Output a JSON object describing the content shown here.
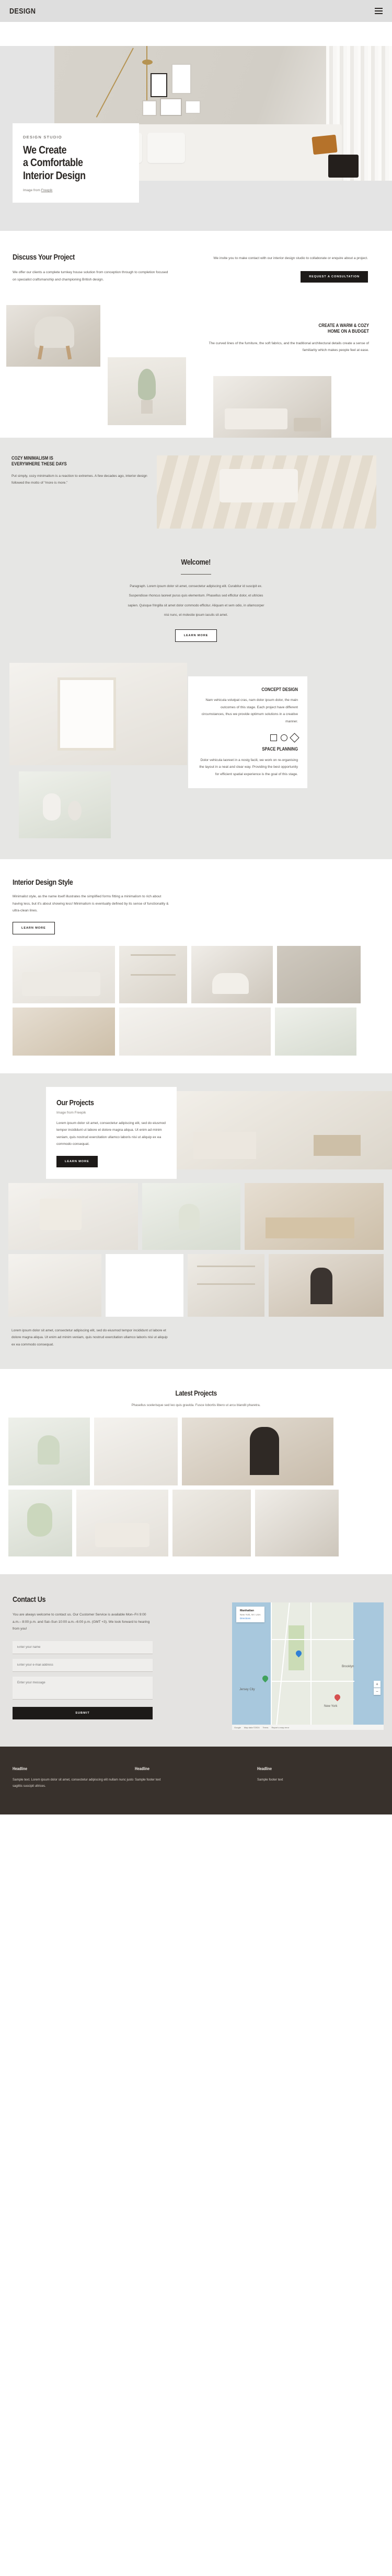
{
  "header": {
    "logo": "DESIGN",
    "menu_icon": "hamburger-icon"
  },
  "hero": {
    "kicker": "DESIGN STUDIO",
    "title": "We Create\na Comfortable\nInterior Design",
    "credit_prefix": "Image from ",
    "credit_link": "Freepik"
  },
  "discuss": {
    "title": "Discuss Your Project",
    "body": "We offer our clients a complete turnkey house solution from conception through to completion focused on specialist craftsmanship and championing British design.",
    "invite": "We invite you to make contact with our interior design studio to collaborate or enquire about a project.",
    "button": "REQUEST A CONSULTATION"
  },
  "warm": {
    "title": "CREATE A WARM & COZY\nHOME ON A BUDGET",
    "body": "The curved lines of the furniture, the soft fabrics, and the traditional architectural details create a sense of familiarity which makes people feel at ease."
  },
  "cozy": {
    "title": "COZY MINIMALISM IS\nEVERYWHERE THESE DAYS",
    "body": "Put simply, cozy minimalism is a reaction to extremes. A few decades ago, interior design followed the motto of “more is more.”"
  },
  "welcome": {
    "title": "Welcome!",
    "paragraphs": [
      "Paragraph. Lorem ipsum dolor sit amet, consectetur adipiscing elit. Curabitur id suscipit ex.",
      "Suspendisse rhoncus laoreet purus quis elementum. Phasellus sed efficitur dolor, et ultricies",
      "sapien. Quisque fringilla sit amet dolor commodo efficitur. Aliquam et sem odio, in ullamcorper",
      "nisi nunc, et molestie ipsum iaculis sit amet."
    ],
    "button": "LEARN MORE"
  },
  "concept": {
    "title": "CONCEPT DESIGN",
    "body": "Nam vehicula volutpat cras, nam dolor ipsum dolor, the main outcomes of this stage. Each project have different circumstances, thus we provide optimum solutions in a creative manner.",
    "planning_title": "SPACE PLANNING",
    "planning_body": "Dolor vehicula laoreet in a nostg facili, we work on re-organising the layout in a neat and clear way. Providing the best opportunity for efficient spatial experience is the goal of this stage."
  },
  "style": {
    "title": "Interior Design Style",
    "body": "Minimalist style, as the name itself illustrates the simplified forms fitting a minimalism to rich about having less, but it's about showing less! Minimalism is eventually defined by its sense of functionality & ultra-clean lines.",
    "button": "LEARN MORE"
  },
  "projects": {
    "title": "Our Projects",
    "credit": "Image from Freepik",
    "body": "Lorem ipsum dolor sit amet, consectetur adipiscing elit, sed do eiusmod tempor incididunt ut labore et dolore magna aliqua. Ut enim ad minim veniam, quis nostrud exercitation ullamco laboris nisi ut aliquip ex ea commodo consequat.",
    "button": "LEARN MORE",
    "caption": "Lorem ipsum dolor sit amet, consectetur adipiscing elit, sed do eiusmod tempor incididunt ut labore et dolore magna aliqua. Ut enim ad minim veniam, quis nostrud exercitation ullamco laboris nisi ut aliquip ex ea commodo consequat."
  },
  "latest": {
    "title": "Latest Projects",
    "subtitle": "Phasellus scelerisque sed leo quis gravida. Fusce lobortis libero ut arcu blandit pharetra."
  },
  "contact": {
    "title": "Contact Us",
    "body": "You are always welcome to contact us. Our Customer Service is available Mon–Fri 9:00 a.m.– 8:00 p.m. and Sat–Sun 10:00 a.m.–6:00 p.m. (GMT +3). We look forward to hearing from you!",
    "fields": [
      {
        "name": "name-field",
        "placeholder": "Enter your name"
      },
      {
        "name": "email-field",
        "placeholder": "Enter your e-mail address"
      },
      {
        "name": "message-field",
        "placeholder": "Enter your message"
      }
    ],
    "submit": "SUBMIT",
    "map": {
      "card_title": "Manhattan",
      "card_sub": "New York, NY, USA",
      "directions": "Directions",
      "label_newyork": "New York",
      "label_jersey": "Jersey City",
      "label_brooklyn": "Brooklyn",
      "zoom_in": "+",
      "zoom_out": "−",
      "footer_brand": "Google",
      "footer_data": "Map data ©2024",
      "footer_terms": "Terms",
      "footer_feedback": "Report a map error"
    }
  },
  "footer": {
    "columns": [
      {
        "headline": "Headline",
        "text": "Sample text. Lorem ipsum dolor sit amet, consectetur adipiscing elit nullam nunc justo sagittis suscipit ultrices."
      },
      {
        "headline": "Headline",
        "text": "Sample footer text"
      },
      {
        "headline": "Headline",
        "text": "Sample footer text"
      }
    ]
  },
  "colors": {
    "dark": "#38312c",
    "accent": "#1d1a18",
    "bg": "#e6e6e4"
  }
}
